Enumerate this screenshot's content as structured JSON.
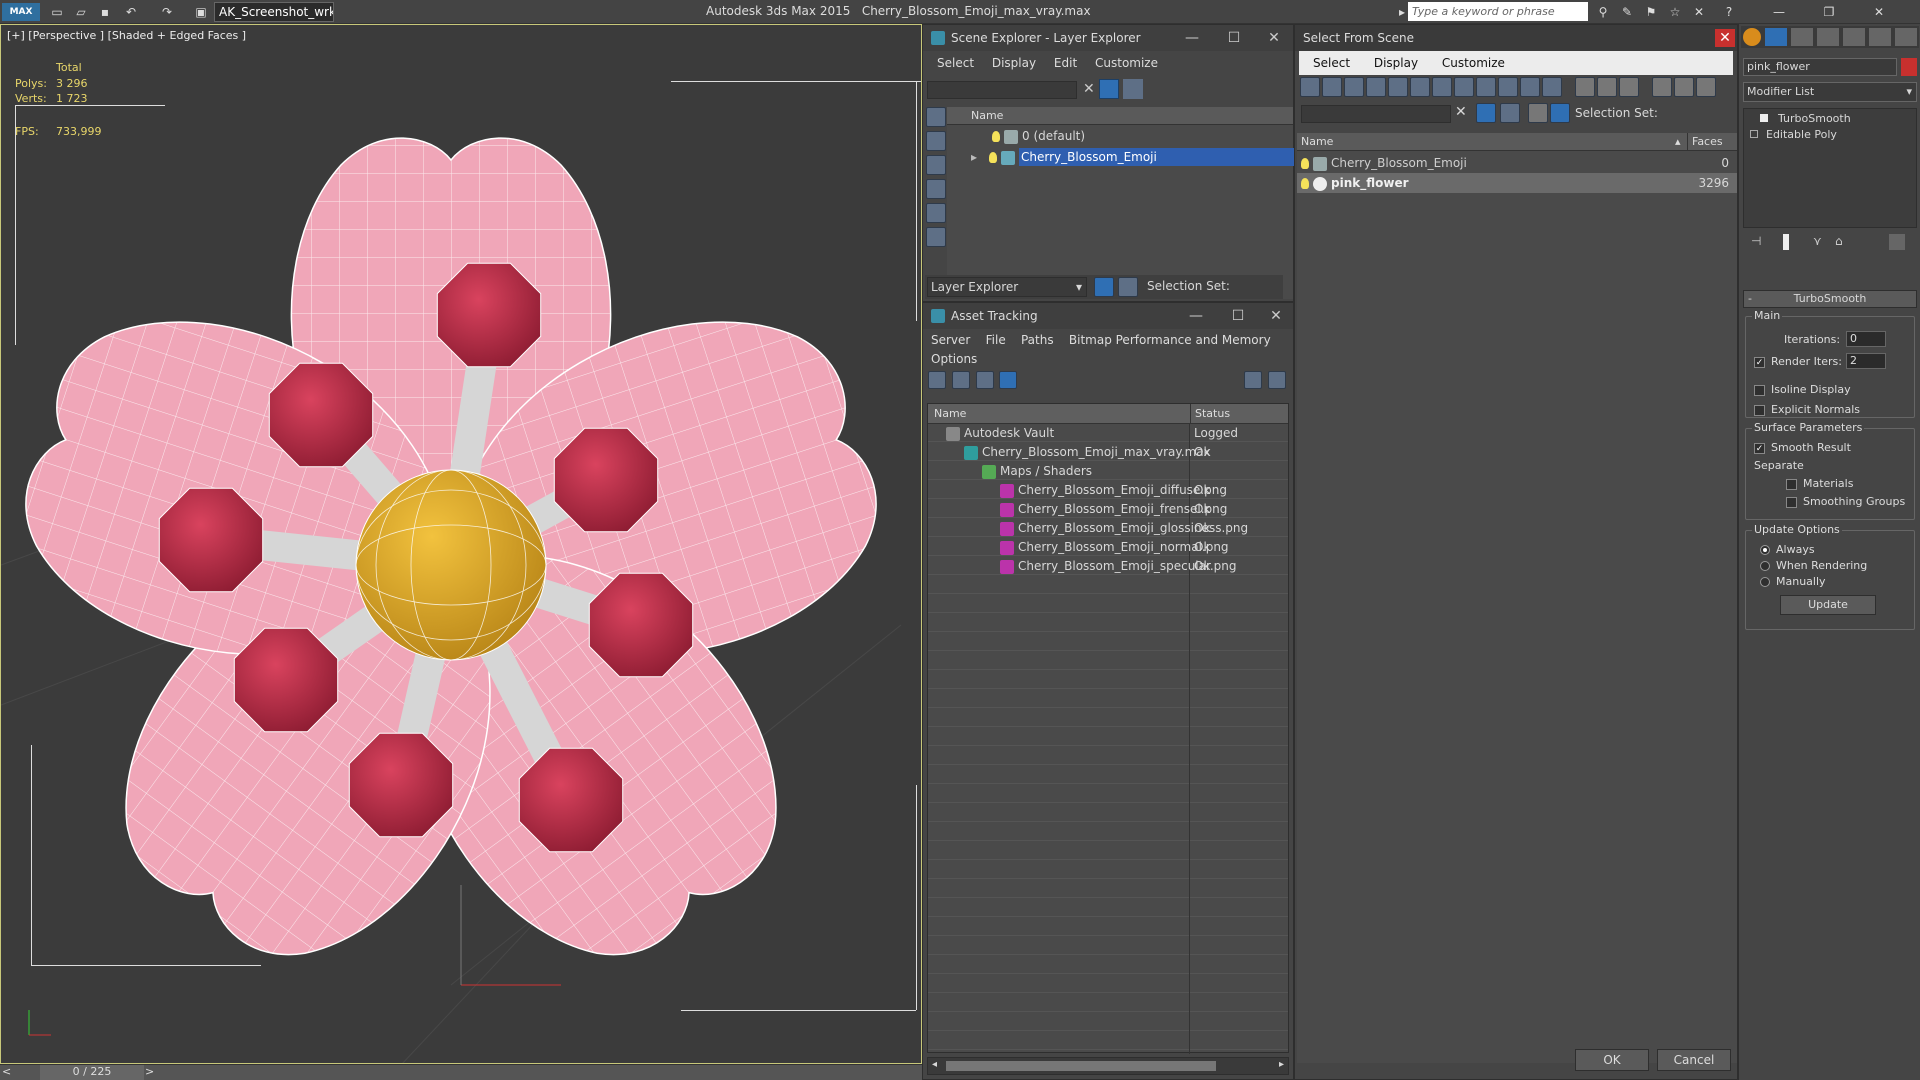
{
  "app": {
    "title": "Autodesk 3ds Max  2015",
    "file": "Cherry_Blossom_Emoji_max_vray.max",
    "workspace": "AK_Screenshot_wrksp",
    "search_placeholder": "Type a keyword or phrase",
    "logo": "MAX"
  },
  "viewport": {
    "label": "[+] [Perspective ] [Shaded + Edged Faces ]",
    "stats": {
      "total_label": "Total",
      "polys_label": "Polys:",
      "polys": "3 296",
      "verts_label": "Verts:",
      "verts": "1 723",
      "fps_label": "FPS:",
      "fps": "733,999"
    },
    "timeline": "0 / 225",
    "colors": {
      "petal": "#f0a6b8",
      "stamen": "#d9435e",
      "center": "#f2c23e"
    }
  },
  "scene_explorer": {
    "title": "Scene Explorer - Layer Explorer",
    "menu": [
      "Select",
      "Display",
      "Edit",
      "Customize"
    ],
    "column": "Name",
    "rows": [
      {
        "label": "0 (default)"
      },
      {
        "label": "Cherry_Blossom_Emoji"
      }
    ],
    "footer_label": "Layer Explorer",
    "selection_set": "Selection Set:"
  },
  "asset_tracking": {
    "title": "Asset Tracking",
    "menu": [
      "Server",
      "File",
      "Paths",
      "Bitmap Performance and Memory",
      "Options"
    ],
    "col_name": "Name",
    "col_status": "Status",
    "rows": [
      {
        "name": "Autodesk Vault",
        "status": "Logged"
      },
      {
        "name": "Cherry_Blossom_Emoji_max_vray.max",
        "status": "Ok"
      },
      {
        "name": "Maps / Shaders",
        "status": ""
      },
      {
        "name": "Cherry_Blossom_Emoji_diffuse.png",
        "status": "Ok"
      },
      {
        "name": "Cherry_Blossom_Emoji_frensel.png",
        "status": "Ok"
      },
      {
        "name": "Cherry_Blossom_Emoji_glossiness.png",
        "status": "Ok"
      },
      {
        "name": "Cherry_Blossom_Emoji_normal.png",
        "status": "Ok"
      },
      {
        "name": "Cherry_Blossom_Emoji_specular.png",
        "status": "Ok"
      }
    ]
  },
  "select_from_scene": {
    "title": "Select From Scene",
    "menu": [
      "Select",
      "Display",
      "Customize"
    ],
    "selection_set": "Selection Set:",
    "col_name": "Name",
    "col_faces": "Faces",
    "rows": [
      {
        "name": "Cherry_Blossom_Emoji",
        "faces": "0"
      },
      {
        "name": "pink_flower",
        "faces": "3296"
      }
    ],
    "ok": "OK",
    "cancel": "Cancel"
  },
  "command_panel": {
    "object_name": "pink_flower",
    "modifier_list": "Modifier List",
    "stack": [
      "TurboSmooth",
      "Editable Poly"
    ],
    "rollout": "TurboSmooth",
    "main": "Main",
    "iterations_label": "Iterations:",
    "iterations": "0",
    "render_iters_label": "Render Iters:",
    "render_iters": "2",
    "isoline": "Isoline Display",
    "explicit": "Explicit Normals",
    "surface": "Surface Parameters",
    "smooth_result": "Smooth Result",
    "separate": "Separate",
    "materials": "Materials",
    "smoothing_groups": "Smoothing Groups",
    "update_options": "Update Options",
    "always": "Always",
    "when_rendering": "When Rendering",
    "manually": "Manually",
    "update": "Update"
  }
}
